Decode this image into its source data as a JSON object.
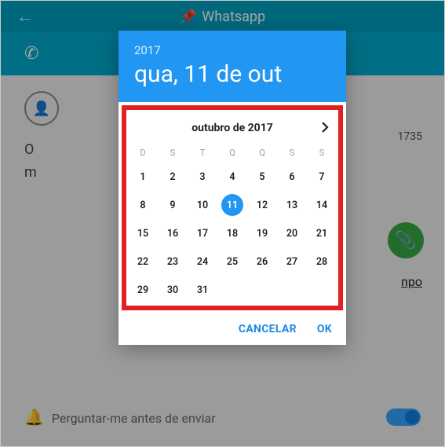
{
  "app": {
    "title": "Whatsapp",
    "msg1": "O",
    "msg2": "m",
    "footer": "Perguntar-me antes de enviar",
    "sideNum": "1735",
    "sideMpo": "npo"
  },
  "dialog": {
    "year": "2017",
    "date": "qua, 11 de out",
    "month": "outubro de 2017",
    "dow": [
      "D",
      "S",
      "T",
      "Q",
      "Q",
      "S",
      "S"
    ],
    "weeks": [
      [
        {
          "n": "1",
          "prev": true
        },
        {
          "n": "2",
          "prev": true
        },
        {
          "n": "3",
          "prev": true
        },
        {
          "n": "4",
          "prev": true
        },
        {
          "n": "5",
          "prev": true
        },
        {
          "n": "6",
          "prev": true
        },
        {
          "n": "7",
          "prev": true
        }
      ],
      [
        {
          "n": "8",
          "prev": true
        },
        {
          "n": "9",
          "prev": true
        },
        {
          "n": "10",
          "prev": true
        },
        {
          "n": "11",
          "sel": true
        },
        {
          "n": "12"
        },
        {
          "n": "13"
        },
        {
          "n": "14"
        }
      ],
      [
        {
          "n": "15"
        },
        {
          "n": "16"
        },
        {
          "n": "17"
        },
        {
          "n": "18"
        },
        {
          "n": "19"
        },
        {
          "n": "20"
        },
        {
          "n": "21"
        }
      ],
      [
        {
          "n": "22"
        },
        {
          "n": "23"
        },
        {
          "n": "24"
        },
        {
          "n": "25"
        },
        {
          "n": "26"
        },
        {
          "n": "27"
        },
        {
          "n": "28"
        }
      ],
      [
        {
          "n": "29"
        },
        {
          "n": "30"
        },
        {
          "n": "31"
        },
        {
          "n": ""
        },
        {
          "n": ""
        },
        {
          "n": ""
        },
        {
          "n": ""
        }
      ]
    ],
    "cancel": "CANCELAR",
    "ok": "OK"
  }
}
